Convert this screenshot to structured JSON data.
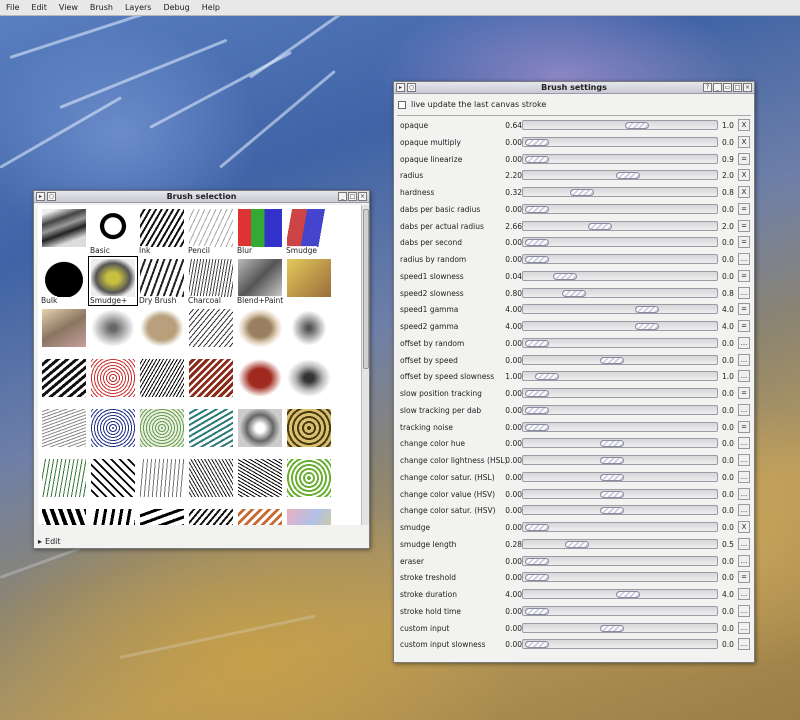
{
  "menubar": [
    "File",
    "Edit",
    "View",
    "Brush",
    "Layers",
    "Debug",
    "Help"
  ],
  "brush_selection": {
    "title": "Brush selection",
    "brushes": [
      {
        "label": "",
        "thumb": "gray-strokes"
      },
      {
        "label": "Basic",
        "thumb": "black-B"
      },
      {
        "label": "Ink",
        "thumb": "ink-strokes"
      },
      {
        "label": "Pencil",
        "thumb": "pencil-strokes"
      },
      {
        "label": "Blur",
        "thumb": "color-blur"
      },
      {
        "label": "Smudge",
        "thumb": "color-smudge"
      },
      {
        "label": "Bulk",
        "thumb": "black-blob"
      },
      {
        "label": "Smudge+",
        "thumb": "olive-smudge",
        "selected": true
      },
      {
        "label": "Dry Brush",
        "thumb": "dry-strokes"
      },
      {
        "label": "Charcoal",
        "thumb": "charcoal"
      },
      {
        "label": "Blend+Paint",
        "thumb": "blend-paint"
      },
      {
        "label": "",
        "thumb": "pick-and-drag"
      },
      {
        "label": "",
        "thumb": "tan-strokes"
      },
      {
        "label": "",
        "thumb": "soft-gray"
      },
      {
        "label": "",
        "thumb": "tan-blob"
      },
      {
        "label": "",
        "thumb": "sketch-lines"
      },
      {
        "label": "",
        "thumb": "tan-spots"
      },
      {
        "label": "",
        "thumb": "spray-dots"
      },
      {
        "label": "",
        "thumb": "black-rough"
      },
      {
        "label": "",
        "thumb": "red-dots"
      },
      {
        "label": "",
        "thumb": "black-hatch"
      },
      {
        "label": "",
        "thumb": "red-brown-strokes"
      },
      {
        "label": "",
        "thumb": "red-soft"
      },
      {
        "label": "",
        "thumb": "gray-cloud"
      },
      {
        "label": "",
        "thumb": "gray-fan"
      },
      {
        "label": "",
        "thumb": "blue-speckle"
      },
      {
        "label": "",
        "thumb": "green-speckle"
      },
      {
        "label": "",
        "thumb": "teal-strokes"
      },
      {
        "label": "",
        "thumb": "metal-bubbles"
      },
      {
        "label": "",
        "thumb": "leopard"
      },
      {
        "label": "",
        "thumb": "green-grass"
      },
      {
        "label": "",
        "thumb": "black-leaves"
      },
      {
        "label": "",
        "thumb": "gray-grass"
      },
      {
        "label": "",
        "thumb": "dark-scribble"
      },
      {
        "label": "",
        "thumb": "black-scribble"
      },
      {
        "label": "",
        "thumb": "green-dots"
      },
      {
        "label": "",
        "thumb": "black-tentacles"
      },
      {
        "label": "",
        "thumb": "black-curls"
      },
      {
        "label": "",
        "thumb": "black-dashes"
      },
      {
        "label": "",
        "thumb": "dark-hatch"
      },
      {
        "label": "",
        "thumb": "orange-strokes"
      },
      {
        "label": "",
        "thumb": "rainbow-strokes"
      }
    ],
    "edit_label": "Edit"
  },
  "brush_settings": {
    "title": "Brush settings",
    "live_update_label": "live update the last canvas stroke",
    "rows": [
      {
        "label": "opaque",
        "value": "0.64",
        "position": 0.6,
        "base": "1.0",
        "button": "X"
      },
      {
        "label": "opaque multiply",
        "value": "0.00",
        "position": 0.0,
        "base": "0.0",
        "button": "X"
      },
      {
        "label": "opaque linearize",
        "value": "0.00",
        "position": 0.0,
        "base": "0.9",
        "button": "="
      },
      {
        "label": "radius",
        "value": "2.20",
        "position": 0.55,
        "base": "2.0",
        "button": "X"
      },
      {
        "label": "hardness",
        "value": "0.32",
        "position": 0.27,
        "base": "0.8",
        "button": "X"
      },
      {
        "label": "dabs per basic radius",
        "value": "0.00",
        "position": 0.0,
        "base": "0.0",
        "button": "="
      },
      {
        "label": "dabs per actual radius",
        "value": "2.66",
        "position": 0.38,
        "base": "2.0",
        "button": "="
      },
      {
        "label": "dabs per second",
        "value": "0.00",
        "position": 0.0,
        "base": "0.0",
        "button": "="
      },
      {
        "label": "radius by random",
        "value": "0.00",
        "position": 0.0,
        "base": "0.0",
        "button": "..."
      },
      {
        "label": "speed1 slowness",
        "value": "0.04",
        "position": 0.17,
        "base": "0.0",
        "button": "="
      },
      {
        "label": "speed2 slowness",
        "value": "0.80",
        "position": 0.22,
        "base": "0.8",
        "button": "..."
      },
      {
        "label": "speed1 gamma",
        "value": "4.00",
        "position": 0.66,
        "base": "4.0",
        "button": "="
      },
      {
        "label": "speed2 gamma",
        "value": "4.00",
        "position": 0.66,
        "base": "4.0",
        "button": "="
      },
      {
        "label": "offset by random",
        "value": "0.00",
        "position": 0.0,
        "base": "0.0",
        "button": "..."
      },
      {
        "label": "offset by speed",
        "value": "0.00",
        "position": 0.45,
        "base": "0.0",
        "button": "..."
      },
      {
        "label": "offset by speed slowness",
        "value": "1.00",
        "position": 0.06,
        "base": "1.0",
        "button": "..."
      },
      {
        "label": "slow position tracking",
        "value": "0.00",
        "position": 0.0,
        "base": "0.0",
        "button": "="
      },
      {
        "label": "slow tracking per dab",
        "value": "0.00",
        "position": 0.0,
        "base": "0.0",
        "button": "..."
      },
      {
        "label": "tracking noise",
        "value": "0.00",
        "position": 0.0,
        "base": "0.0",
        "button": "="
      },
      {
        "label": "change color hue",
        "value": "0.00",
        "position": 0.45,
        "base": "0.0",
        "button": "..."
      },
      {
        "label": "change color lightness (HSL)",
        "value": "0.00",
        "position": 0.45,
        "base": "0.0",
        "button": "..."
      },
      {
        "label": "change color satur. (HSL)",
        "value": "0.00",
        "position": 0.45,
        "base": "0.0",
        "button": "..."
      },
      {
        "label": "change color value (HSV)",
        "value": "0.00",
        "position": 0.45,
        "base": "0.0",
        "button": "..."
      },
      {
        "label": "change color satur. (HSV)",
        "value": "0.00",
        "position": 0.45,
        "base": "0.0",
        "button": "..."
      },
      {
        "label": "smudge",
        "value": "0.00",
        "position": 0.0,
        "base": "0.0",
        "button": "X"
      },
      {
        "label": "smudge length",
        "value": "0.28",
        "position": 0.24,
        "base": "0.5",
        "button": "..."
      },
      {
        "label": "eraser",
        "value": "0.00",
        "position": 0.0,
        "base": "0.0",
        "button": "..."
      },
      {
        "label": "stroke treshold",
        "value": "0.00",
        "position": 0.0,
        "base": "0.0",
        "button": "="
      },
      {
        "label": "stroke duration",
        "value": "4.00",
        "position": 0.55,
        "base": "4.0",
        "button": "..."
      },
      {
        "label": "stroke hold time",
        "value": "0.00",
        "position": 0.0,
        "base": "0.0",
        "button": "..."
      },
      {
        "label": "custom input",
        "value": "0.00",
        "position": 0.45,
        "base": "0.0",
        "button": "..."
      },
      {
        "label": "custom input slowness",
        "value": "0.00",
        "position": 0.0,
        "base": "0.0",
        "button": "..."
      }
    ]
  }
}
